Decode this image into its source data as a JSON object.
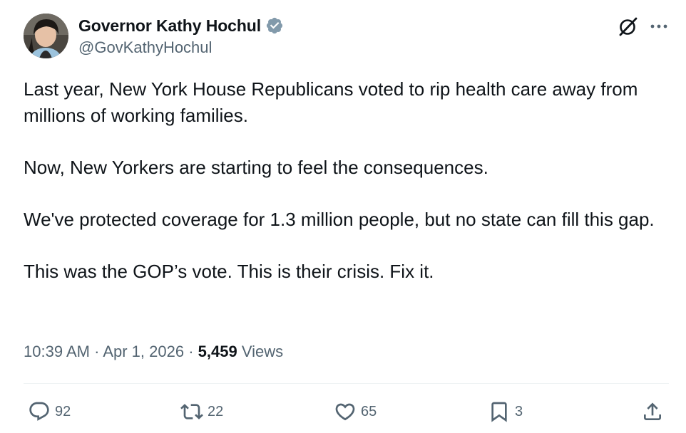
{
  "author": {
    "display_name": "Governor Kathy Hochul",
    "handle": "@GovKathyHochul",
    "verified_badge_icon": "verified-badge-icon",
    "verified_color": "#829aab"
  },
  "header_actions": {
    "grok_icon": "grok-icon",
    "more_icon": "more-options-icon"
  },
  "tweet": {
    "paragraphs": [
      "Last year, New York House Republicans voted to rip health care away from millions of working families.",
      "Now, New Yorkers are starting to feel the consequences.",
      "We've protected coverage for 1.3 million people, but no state can fill this gap.",
      "This was the GOP’s vote. This is their crisis. Fix it."
    ],
    "time": "10:39 AM",
    "date": "Apr 1, 2026",
    "separator": "·",
    "views_count": "5,459",
    "views_label": "Views"
  },
  "engagement": {
    "replies": "92",
    "reposts": "22",
    "likes": "65",
    "bookmarks": "3"
  },
  "colors": {
    "text_primary": "#0f1419",
    "text_secondary": "#536471",
    "divider": "#eff3f4"
  }
}
